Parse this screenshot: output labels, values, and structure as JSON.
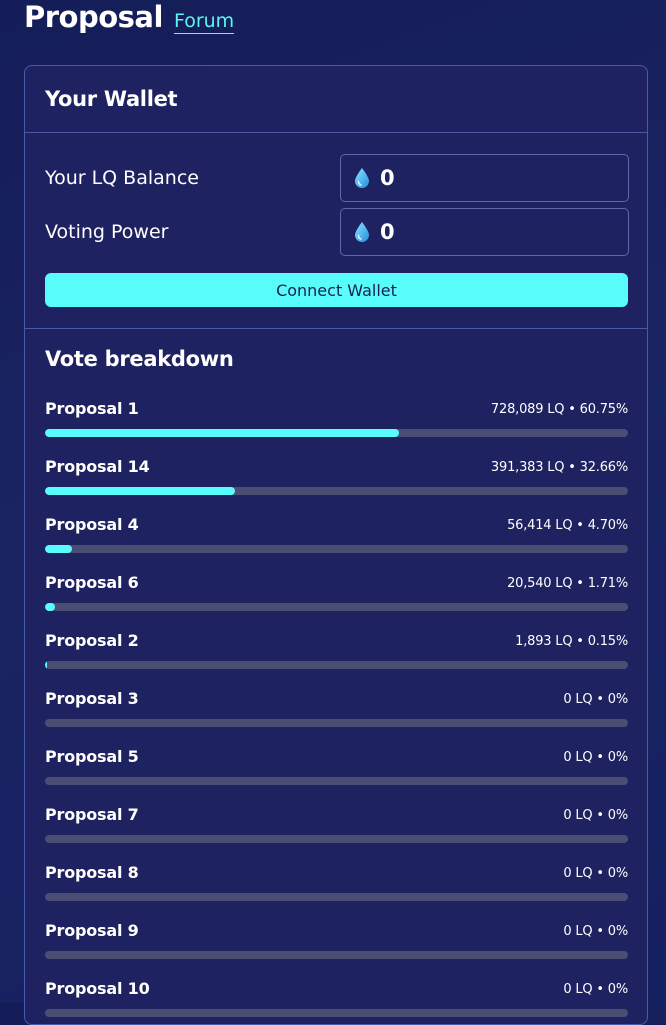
{
  "header": {
    "title": "Proposal",
    "forum_link": "Forum"
  },
  "wallet": {
    "title": "Your Wallet",
    "balance_label": "Your LQ Balance",
    "balance_value": "0",
    "voting_power_label": "Voting Power",
    "voting_power_value": "0",
    "connect_button": "Connect Wallet"
  },
  "breakdown": {
    "title": "Vote breakdown",
    "proposals": [
      {
        "name": "Proposal 1",
        "stats": "728,089 LQ • 60.75%",
        "percent": 60.75
      },
      {
        "name": "Proposal 14",
        "stats": "391,383 LQ • 32.66%",
        "percent": 32.66
      },
      {
        "name": "Proposal 4",
        "stats": "56,414 LQ • 4.70%",
        "percent": 4.7
      },
      {
        "name": "Proposal 6",
        "stats": "20,540 LQ • 1.71%",
        "percent": 1.71
      },
      {
        "name": "Proposal 2",
        "stats": "1,893 LQ • 0.15%",
        "percent": 0.15
      },
      {
        "name": "Proposal 3",
        "stats": "0 LQ • 0%",
        "percent": 0
      },
      {
        "name": "Proposal 5",
        "stats": "0 LQ • 0%",
        "percent": 0
      },
      {
        "name": "Proposal 7",
        "stats": "0 LQ • 0%",
        "percent": 0
      },
      {
        "name": "Proposal 8",
        "stats": "0 LQ • 0%",
        "percent": 0
      },
      {
        "name": "Proposal 9",
        "stats": "0 LQ • 0%",
        "percent": 0
      },
      {
        "name": "Proposal 10",
        "stats": "0 LQ • 0%",
        "percent": 0
      }
    ]
  },
  "colors": {
    "accent": "#58fdfb",
    "card_bg": "#1f2260",
    "track": "#4a4d74"
  },
  "icons": {
    "token": "water-drop-icon"
  }
}
